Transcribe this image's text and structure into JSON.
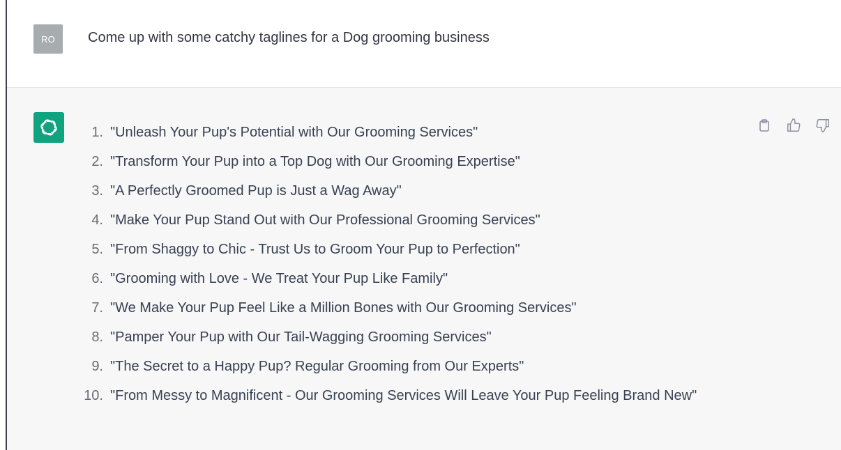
{
  "user_message": {
    "avatar_initials": "RO",
    "text": "Come up with some catchy taglines for a Dog grooming business"
  },
  "assistant_message": {
    "avatar_icon": "openai-logo-icon",
    "items": [
      {
        "num": "1.",
        "text": "\"Unleash Your Pup's Potential with Our Grooming Services\""
      },
      {
        "num": "2.",
        "text": "\"Transform Your Pup into a Top Dog with Our Grooming Expertise\""
      },
      {
        "num": "3.",
        "text": "\"A Perfectly Groomed Pup is Just a Wag Away\""
      },
      {
        "num": "4.",
        "text": "\"Make Your Pup Stand Out with Our Professional Grooming Services\""
      },
      {
        "num": "5.",
        "text": "\"From Shaggy to Chic - Trust Us to Groom Your Pup to Perfection\""
      },
      {
        "num": "6.",
        "text": "\"Grooming with Love - We Treat Your Pup Like Family\""
      },
      {
        "num": "7.",
        "text": "\"We Make Your Pup Feel Like a Million Bones with Our Grooming Services\""
      },
      {
        "num": "8.",
        "text": "\"Pamper Your Pup with Our Tail-Wagging Grooming Services\""
      },
      {
        "num": "9.",
        "text": "\"The Secret to a Happy Pup? Regular Grooming from Our Experts\""
      },
      {
        "num": "10.",
        "text": "\"From Messy to Magnificent - Our Grooming Services Will Leave Your Pup Feeling Brand New\""
      }
    ],
    "actions": [
      "clipboard-icon",
      "thumbs-up-icon",
      "thumbs-down-icon"
    ]
  },
  "colors": {
    "assistant_bg": "#f7f7f8",
    "bot_avatar": "#10a37f",
    "user_avatar": "#a7adae",
    "text": "#374151"
  }
}
